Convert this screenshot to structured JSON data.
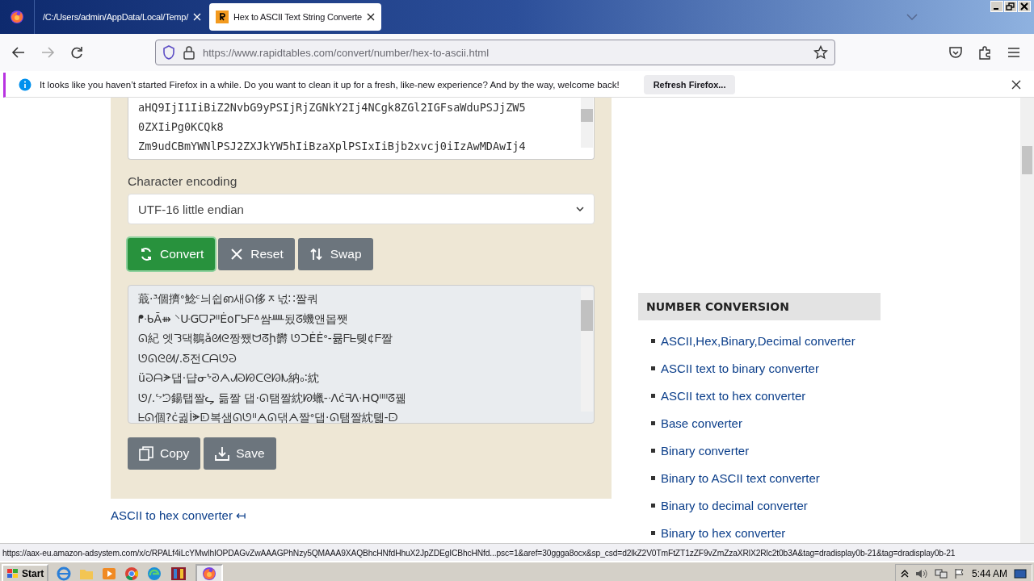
{
  "browser": {
    "tabs": [
      {
        "title": "/C:/Users/admin/AppData/Local/Temp/",
        "selected": false
      },
      {
        "title": "Hex to ASCII Text String Converte",
        "selected": true
      }
    ],
    "url": "https://www.rapidtables.com/convert/number/hex-to-ascii.html",
    "notice": {
      "message": "It looks like you haven’t started Firefox in a while. Do you want to clean it up for a fresh, like-new experience? And by the way, welcome back!",
      "button": "Refresh Firefox..."
    }
  },
  "converter": {
    "input_lines": [
      "aHQ9IjI1IiBiZ2NvbG9yPSIjRjZGNkY2Ij4NCgk8ZGl2IGFsaWduPSJjZW5",
      "0ZXIiPg0KCQk8",
      "Zm9udCBmYWNlPSJ2ZXJkYW5hIiBzaXplPSIxIiBjb2xvcj0iIzAwMDAwIj4"
    ],
    "encoding_label": "Character encoding",
    "encoding": "UTF-16 little endian",
    "buttons": [
      {
        "label": "Convert",
        "kind": "convert"
      },
      {
        "label": "Reset",
        "kind": "reset"
      },
      {
        "label": "Swap",
        "kind": "swap"
      }
    ],
    "output_lines": [
      "蕺·³個擠ᐤ鯰ᶜ늬쉽ഩ새ᘏ侈ᆽ넋∷짤쿼",
      "ᖰᐧᑲĀ⇻ ⸌ᑘGᗜᕈᐦĖoΓᕊᖴᐞ쌈ᚉ됬ᘔ蟣앤몹쨋",
      "ᘏ紀 엣ᘊ댁鶵ǎᘛᘓ짱쨌ᗢᘔḩ欝 ᘎᑐĖĖᐤ-뮮ᖴᖶ톚¢ᖴ짤",
      "ᘎᘏᘓᘛ/.ᘕ전ᑕᗩᘎᘒ",
      "üᘒᗩᗘ댑·댭ᓂᖮᘑᗅᗂᘒᘗᑕᘓᘙᗃ納ₒ∶紞",
      "ᘎ/.ᖦᘦ鍚탭짤ᖤ 듦짤 댑·ᘏ탬짤紞ᘗ蠟-ᐧᐱċᖷᐱᐧHQᐦᐦᘔ꿺",
      "ᖶᘏ個?ċ귏Ìᗙᗟ복샘ᘏᘎᐦᗅᘏ댂ᗅ짤ᐤ댑·ᘏ탬짤紞톏-ᗠ"
    ],
    "output_buttons": [
      {
        "label": "Copy",
        "kind": "copy"
      },
      {
        "label": "Save",
        "kind": "save"
      }
    ],
    "related_link": "ASCII to hex converter ↤"
  },
  "sidebar": {
    "heading": "NUMBER CONVERSION",
    "links": [
      "ASCII,Hex,Binary,Decimal converter",
      "ASCII text to binary converter",
      "ASCII text to hex converter",
      "Base converter",
      "Binary converter",
      "Binary to ASCII text converter",
      "Binary to decimal converter",
      "Binary to hex converter"
    ]
  },
  "status_url": "https://aax-eu.amazon-adsystem.com/x/c/RPALf4iLcYMwIhIOPDAGvZwAAAGPhNzy5QMAAA9XAQBhcHNfdHhuX2JpZDEgICBhcHNfd...psc=1&aref=30ggga8ocx&sp_csd=d2lkZ2V0TmFtZT1zZF9vZmZzaXRlX2Rlc2t0b3A&tag=dradisplay0b-21&tag=dradisplay0b-21",
  "taskbar": {
    "start": "Start",
    "clock": "5:44 AM"
  }
}
